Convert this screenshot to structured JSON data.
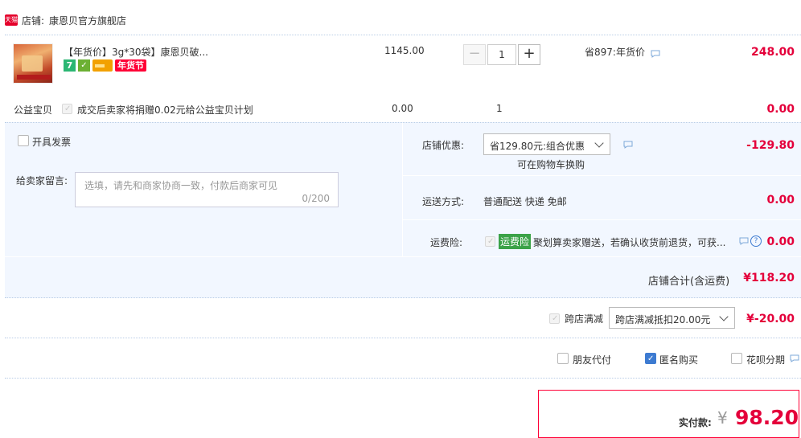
{
  "shop": {
    "badge": "天猫",
    "label": "店铺:",
    "name": "康恩贝官方旗舰店"
  },
  "item": {
    "title": "【年货价】3g*30袋】康恩贝破...",
    "price": "1145.00",
    "qty": "1",
    "promo": "省897:年货价",
    "subtotal": "248.00",
    "tags": {
      "seven": "7",
      "festival": "年货节"
    }
  },
  "charity": {
    "label": "公益宝贝",
    "text": "成交后卖家将捐赠0.02元给公益宝贝计划",
    "price": "0.00",
    "qty": "1",
    "amount": "0.00"
  },
  "invoice": {
    "label": "开具发票"
  },
  "message": {
    "label": "给卖家留言:",
    "placeholder": "选填，请先和商家协商一致，付款后商家可见",
    "count": "0/200"
  },
  "discount": {
    "label": "店铺优惠:",
    "selected": "省129.80元:组合优惠",
    "note": "可在购物车换购",
    "amount": "-129.80"
  },
  "shipping": {
    "label": "运送方式:",
    "value": "普通配送 快递 免邮",
    "amount": "0.00"
  },
  "insurance": {
    "label": "运费险:",
    "tag": "运费险",
    "text": "聚划算卖家赠送，若确认收货前退货，可获...",
    "amount": "0.00"
  },
  "store_total": {
    "label": "店铺合计(含运费)",
    "amount": "¥118.20"
  },
  "cross": {
    "label": "跨店满减",
    "selected": "跨店满减抵扣20.00元",
    "amount": "¥-20.00"
  },
  "options": {
    "friend": "朋友代付",
    "anon": "匿名购买",
    "huabei": "花呗分期"
  },
  "pay": {
    "label": "实付款:",
    "currency": "¥",
    "amount": "98.20"
  },
  "colors": {
    "accent": "#e4003a",
    "panel": "#f2f7ff",
    "border": "#b9cde6",
    "check": "#3d7bd1",
    "green": "#3ba248",
    "tmall": "#e5002b"
  }
}
